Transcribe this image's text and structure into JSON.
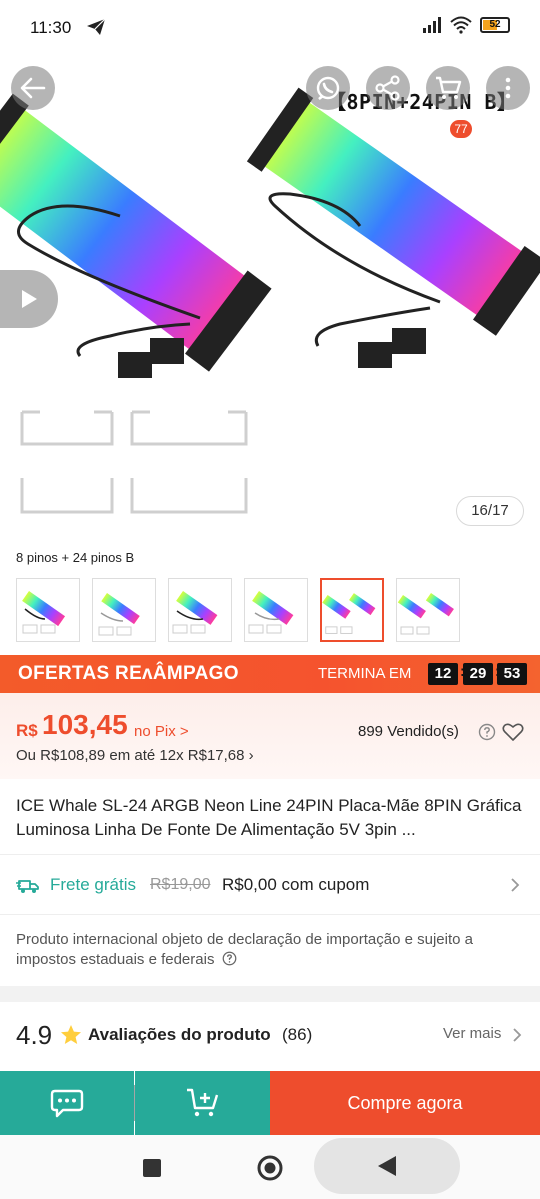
{
  "status_bar": {
    "time": "11:30",
    "battery": "52",
    "icons": [
      "telegram-send-icon",
      "signal-icon",
      "wifi-icon",
      "battery-icon"
    ]
  },
  "hero": {
    "variant_title": "【8PIN+24PIN B】",
    "cart_badge": "77",
    "image_counter": "16/17",
    "icons": [
      "back-arrow-icon",
      "whatsapp-icon",
      "share-icon",
      "cart-icon",
      "more-vertical-icon",
      "play-icon"
    ]
  },
  "variant": {
    "label": "8 pinos + 24 pinos B",
    "thumb_captions": [
      "[8Pin with cables]",
      "[8Pin with cables]",
      "[ Variante ]",
      "[ Variante ]",
      "[24Pin with B]",
      "[Variant bundle]"
    ],
    "selected_index": 4
  },
  "flash_sale": {
    "title": "OFERTAS REʌÂMPAGO",
    "ends_label": "TERMINA EM",
    "hours": "12",
    "minutes": "29",
    "seconds": "53"
  },
  "price": {
    "currency": "R$",
    "value": "103,45",
    "suffix": "no Pix >",
    "installments": "Ou R$108,89 em até 12x R$17,68 ›",
    "sold": "899 Vendido(s)"
  },
  "product": {
    "title": "ICE Whale SL-24 ARGB Neon Line 24PIN Placa-Mãe 8PIN Gráfica Luminosa Linha De Fonte De Alimentação 5V 3pin ..."
  },
  "shipping": {
    "label": "Frete grátis",
    "old_price": "R$19,00",
    "new_price": "R$0,00 com cupom"
  },
  "notice": {
    "text": "Produto internacional objeto de declaração de importação e sujeito a impostos estaduais e federais"
  },
  "rating": {
    "score": "4.9",
    "label": "Avaliações do produto",
    "count": "(86)",
    "see_more": "Ver mais"
  },
  "bottom_bar": {
    "buy_label": "Compre agora"
  },
  "colors": {
    "brand": "#ee4d2d",
    "teal": "#26aa99",
    "star": "#ffce3d"
  }
}
